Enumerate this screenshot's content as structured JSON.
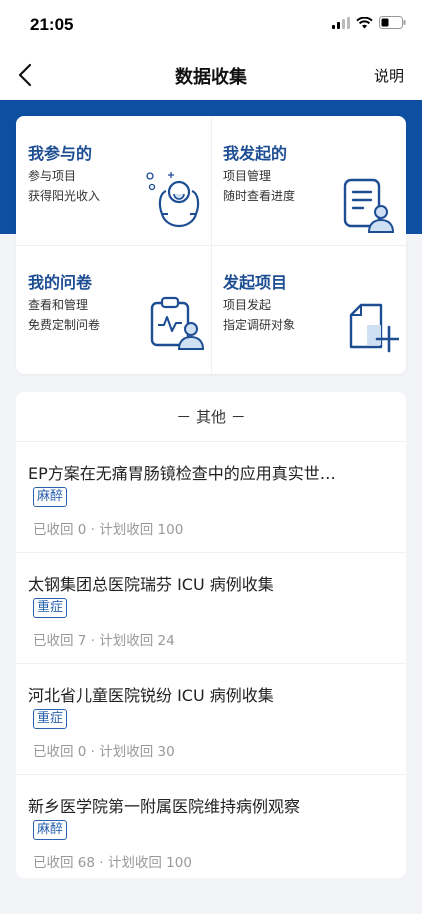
{
  "status_bar": {
    "time": "21:05"
  },
  "nav": {
    "title": "数据收集",
    "help": "说明"
  },
  "tiles": [
    {
      "title": "我参与的",
      "line1": "参与项目",
      "line2": "获得阳光收入",
      "icon": "sunshine-person-icon"
    },
    {
      "title": "我发起的",
      "line1": "项目管理",
      "line2": "随时查看进度",
      "icon": "document-person-icon"
    },
    {
      "title": "我的问卷",
      "line1": "查看和管理",
      "line2": "免费定制问卷",
      "icon": "clipboard-person-icon"
    },
    {
      "title": "发起项目",
      "line1": "项目发起",
      "line2": "指定调研对象",
      "icon": "new-file-plus-icon"
    }
  ],
  "others": {
    "header": "－ 其他 －",
    "projects": [
      {
        "title": "EP方案在无痛胃肠镜检查中的应用真实世…",
        "tag": "麻醉",
        "stats": "已收回 0 · 计划收回 100"
      },
      {
        "title": "太钢集团总医院瑞芬 ICU 病例收集",
        "tag": "重症",
        "stats": "已收回 7 · 计划收回 24"
      },
      {
        "title": "河北省儿童医院锐纷 ICU 病例收集",
        "tag": "重症",
        "stats": "已收回 0 · 计划收回 30"
      },
      {
        "title": "新乡医学院第一附属医院维持病例观察",
        "tag": "麻醉",
        "stats": "已收回 68 · 计划收回 100"
      }
    ]
  },
  "colors": {
    "brand": "#0f4fa1",
    "tile_title": "#1d4d92",
    "tag": "#2a62ad"
  }
}
